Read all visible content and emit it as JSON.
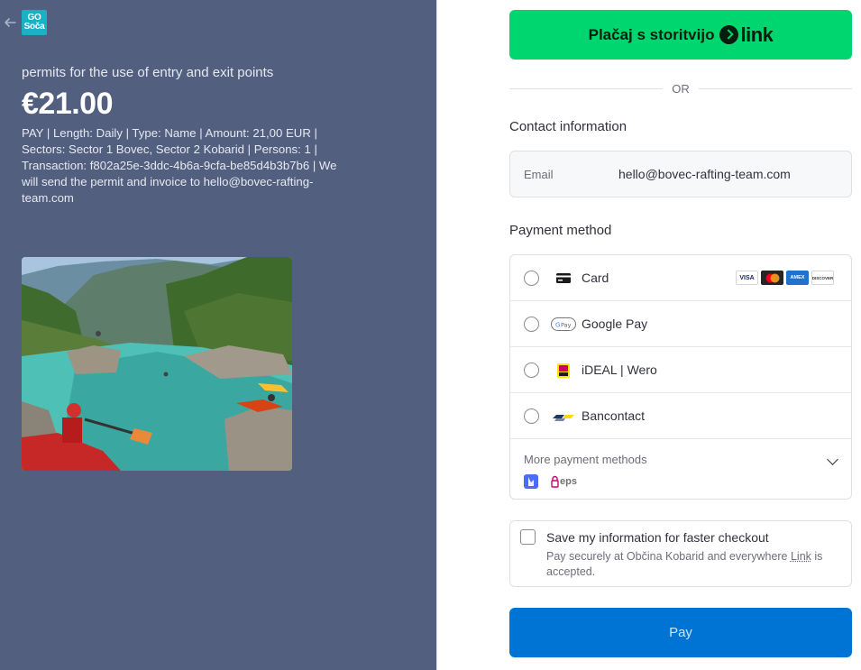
{
  "left": {
    "logo_line1": "GO",
    "logo_line2": "Soča",
    "product_name": "permits for the use of entry and exit points",
    "price": "€21.00",
    "description": "PAY | Length: Daily | Type: Name | Amount: 21,00 EUR | Sectors: Sector 1 Bovec, Sector 2 Kobarid | Persons: 1 | Transaction: f802a25e-3ddc-4b6a-9cfa-be85d4b3b7b6 | We will send the permit and invoice to hello@bovec-rafting-team.com"
  },
  "link_button": {
    "label": "Plačaj s storitvijo",
    "brand": "link",
    "color": "#00d66f"
  },
  "or_text": "OR",
  "contact": {
    "heading": "Contact information",
    "email_label": "Email",
    "email_value": "hello@bovec-rafting-team.com"
  },
  "payment": {
    "heading": "Payment method",
    "methods": [
      {
        "label": "Card",
        "icon": "card-icon"
      },
      {
        "label": "Google Pay",
        "icon": "google-pay-icon"
      },
      {
        "label": "iDEAL | Wero",
        "icon": "ideal-wero-icon"
      },
      {
        "label": "Bancontact",
        "icon": "bancontact-icon"
      }
    ],
    "card_brands": [
      "VISA",
      "mastercard",
      "AMEX",
      "DISCOVER"
    ],
    "more_label": "More payment methods",
    "more_icons": [
      "blik-icon",
      "eps-icon"
    ],
    "eps_text": "eps"
  },
  "save": {
    "title": "Save my information for faster checkout",
    "subtitle_before": "Pay securely at Občina Kobarid and everywhere ",
    "subtitle_link": "Link",
    "subtitle_after": " is accepted."
  },
  "pay_button": {
    "label": "Pay",
    "color": "#0074d4"
  },
  "colors": {
    "left_panel": "#525f7f",
    "logo": "#17b3c5"
  }
}
